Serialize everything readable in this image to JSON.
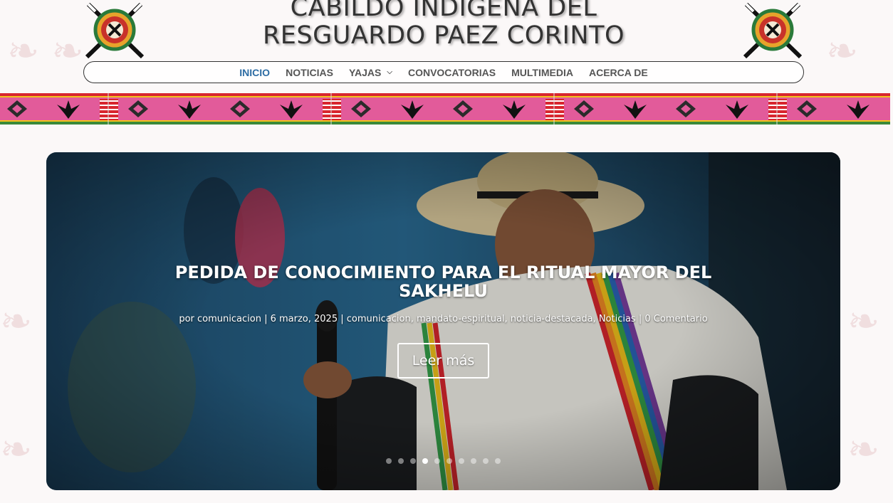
{
  "site": {
    "title_line1": "CABILDO INDIGENA DEL",
    "title_line2": "RESGUARDO PAEZ CORINTO"
  },
  "nav": {
    "items": [
      {
        "label": "INICIO",
        "active": true
      },
      {
        "label": "NOTICIAS",
        "active": false
      },
      {
        "label": "YAJAS",
        "active": false,
        "has_dropdown": true
      },
      {
        "label": "CONVOCATORIAS",
        "active": false
      },
      {
        "label": "MULTIMEDIA",
        "active": false
      },
      {
        "label": "ACERCA DE",
        "active": false
      }
    ],
    "dropdown_icon": "chevron-down-icon"
  },
  "slider": {
    "title": "PEDIDA DE CONOCIMIENTO PARA EL RITUAL MAYOR DEL SAKHELU",
    "meta": {
      "by": "por",
      "author": "comunicacion",
      "date": "6 marzo, 2025",
      "categories": [
        "comunicacion",
        "mandato-espiritual",
        "noticia-destacada",
        "Noticias"
      ],
      "comments": "0 Comentario"
    },
    "button_label": "Leer más",
    "dot_count": 10,
    "active_dot": 3
  },
  "colors": {
    "accent": "#2e6da4",
    "nav_text": "#555555",
    "band_red": "#d8262e",
    "band_pink": "#e25b9a",
    "band_yellow": "#f2c31b"
  }
}
